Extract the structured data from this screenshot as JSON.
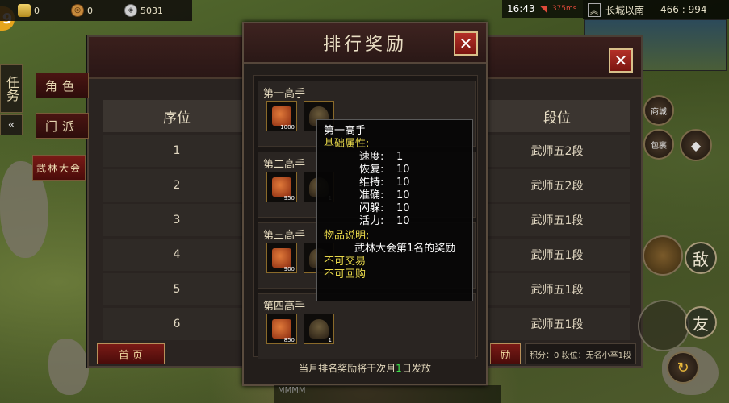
{
  "currency": {
    "gold": "0",
    "coin": "0",
    "silver": "5031"
  },
  "level_badge": "9",
  "status": {
    "time": "16:43",
    "ping": "375ms"
  },
  "location": {
    "name": "长城以南",
    "coords": "466 : 994"
  },
  "side": {
    "task": "任务",
    "collapse": "«"
  },
  "back_panel": {
    "tabs": [
      "角色",
      "门派",
      "武林大会"
    ],
    "columns": {
      "rank": "序位",
      "segment": "段位"
    },
    "rows": [
      {
        "rank": "1",
        "segment": "武师五2段"
      },
      {
        "rank": "2",
        "segment": "武师五2段"
      },
      {
        "rank": "3",
        "segment": "武师五1段"
      },
      {
        "rank": "4",
        "segment": "武师五1段"
      },
      {
        "rank": "5",
        "segment": "武师五1段"
      },
      {
        "rank": "6",
        "segment": "武师五1段"
      }
    ],
    "first_page": "首 页",
    "award_button": "励",
    "my_rank": "积分：0 段位：无名小卒1段",
    "close": "✕"
  },
  "front_panel": {
    "title": "排行奖励",
    "close": "✕",
    "tiers": [
      {
        "name": "第一高手",
        "qty1": "1000",
        "qty2": ""
      },
      {
        "name": "第二高手",
        "qty1": "950",
        "qty2": "1"
      },
      {
        "name": "第三高手",
        "qty1": "900",
        "qty2": ""
      },
      {
        "name": "第四高手",
        "qty1": "850",
        "qty2": "1"
      }
    ],
    "footer_pre": "当月排名奖励将于次月",
    "footer_hl": "1",
    "footer_post": "日发放"
  },
  "tooltip": {
    "title": "第一高手",
    "attr_head": "基础属性:",
    "stats": [
      {
        "k": "速度:",
        "v": "1"
      },
      {
        "k": "恢复:",
        "v": "10"
      },
      {
        "k": "维持:",
        "v": "10"
      },
      {
        "k": "准确:",
        "v": "10"
      },
      {
        "k": "闪躲:",
        "v": "10"
      },
      {
        "k": "活力:",
        "v": "10"
      }
    ],
    "desc_head": "物品说明:",
    "desc": "武林大会第1名的奖励",
    "no_trade": "不可交易",
    "no_recycle": "不可回购"
  },
  "right_controls": {
    "shop": "商城",
    "bag": "包裹",
    "enemy": "敌",
    "friend": "友"
  },
  "chat": "MMMM"
}
